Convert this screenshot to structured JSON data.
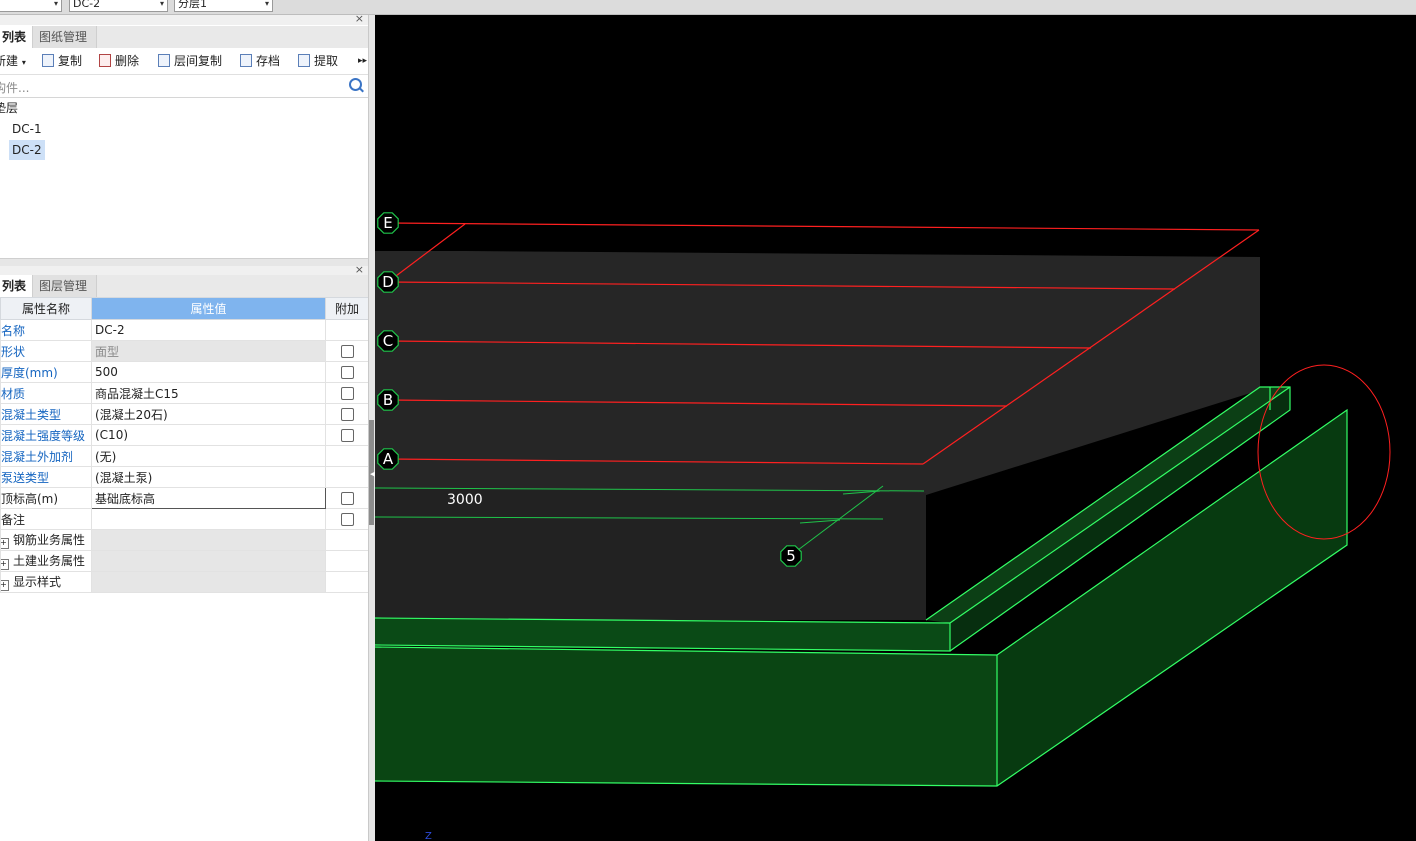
{
  "top_combos": [
    {
      "value": ""
    },
    {
      "value": "DC-2"
    },
    {
      "value": "分层1"
    }
  ],
  "panel1": {
    "tabs": [
      "列表",
      "图纸管理"
    ],
    "toolbar": [
      {
        "label": "新建",
        "icon": "new-icon"
      },
      {
        "label": "复制",
        "icon": "copy-icon"
      },
      {
        "label": "删除",
        "icon": "delete-icon"
      },
      {
        "label": "层间复制",
        "icon": "floor-copy-icon"
      },
      {
        "label": "存档",
        "icon": "archive-icon"
      },
      {
        "label": "提取",
        "icon": "extract-icon"
      }
    ],
    "search_placeholder": "构件...",
    "tree": {
      "root": "垫层",
      "items": [
        "DC-1",
        "DC-2"
      ],
      "selected": "DC-2"
    }
  },
  "panel2": {
    "tabs": [
      "列表",
      "图层管理"
    ],
    "headers": [
      "属性名称",
      "属性值",
      "附加"
    ],
    "rows": [
      {
        "name": "名称",
        "value": "DC-2",
        "check": false,
        "has_check": false
      },
      {
        "name": "形状",
        "value": "面型",
        "check": false,
        "has_check": true,
        "gray": true
      },
      {
        "name": "厚度(mm)",
        "value": "500",
        "check": false,
        "has_check": true
      },
      {
        "name": "材质",
        "value": "商品混凝土C15",
        "check": false,
        "has_check": true
      },
      {
        "name": "混凝土类型",
        "value": "(混凝土20石)",
        "check": false,
        "has_check": true
      },
      {
        "name": "混凝土强度等级",
        "value": "(C10)",
        "check": false,
        "has_check": true
      },
      {
        "name": "混凝土外加剂",
        "value": "(无)",
        "check": false,
        "has_check": false
      },
      {
        "name": "泵送类型",
        "value": "(混凝土泵)",
        "check": false,
        "has_check": false
      },
      {
        "name": "顶标高(m)",
        "value": "基础底标高",
        "check": false,
        "has_check": true,
        "black": true,
        "edit": true
      },
      {
        "name": "备注",
        "value": "",
        "check": false,
        "has_check": true,
        "black": true
      }
    ],
    "groups": [
      "钢筋业务属性",
      "土建业务属性",
      "显示样式"
    ]
  },
  "viewport": {
    "axis_labels": [
      "E",
      "D",
      "C",
      "B",
      "A",
      "5"
    ],
    "dimension": "3000",
    "corner_axis": "Z",
    "colors": {
      "axis_line": "#ff2020",
      "edge": "#33ff66",
      "fill": "#0a3d12",
      "slab": "#262626"
    }
  }
}
